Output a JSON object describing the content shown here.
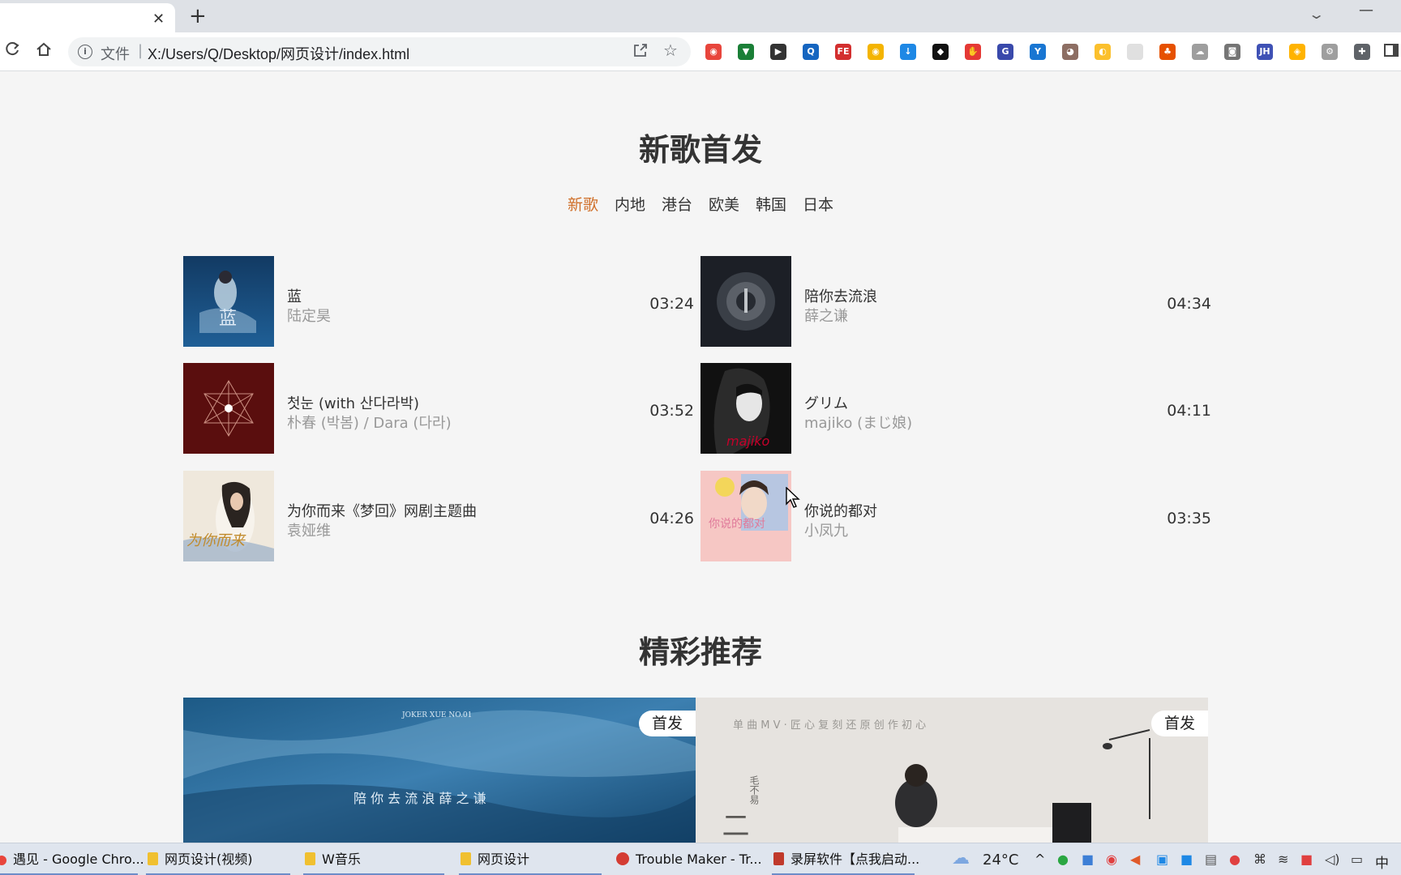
{
  "browser": {
    "tab_close": "✕",
    "new_tab": "+",
    "dropdown": "⌄",
    "minimize": "—",
    "omnibox_label": "文件",
    "omnibox_sep": "|",
    "url": "X:/Users/Q/Desktop/网页设计/index.html",
    "extensions": [
      {
        "name": "chrome-ext-icon",
        "color": "#e8453c",
        "glyph": "◉"
      },
      {
        "name": "shield-ext-icon",
        "color": "#1a7f37",
        "glyph": "▼"
      },
      {
        "name": "dark-ext-icon",
        "color": "#333333",
        "glyph": "▶"
      },
      {
        "name": "search-ext-icon",
        "color": "#1565c0",
        "glyph": "Q"
      },
      {
        "name": "fe-ext-icon",
        "color": "#d32f2f",
        "glyph": "FE"
      },
      {
        "name": "chrome2-ext-icon",
        "color": "#f4b400",
        "glyph": "◉"
      },
      {
        "name": "download-ext-icon",
        "color": "#1e88e5",
        "glyph": "↓"
      },
      {
        "name": "octo-ext-icon",
        "color": "#111111",
        "glyph": "◆"
      },
      {
        "name": "adblock-ext-icon",
        "color": "#e53935",
        "glyph": "✋"
      },
      {
        "name": "g-ext-icon",
        "color": "#3949ab",
        "glyph": "G"
      },
      {
        "name": "y-ext-icon",
        "color": "#1976d2",
        "glyph": "Y"
      },
      {
        "name": "eyes-ext-icon",
        "color": "#8d6e63",
        "glyph": "◕"
      },
      {
        "name": "yellow-ext-icon",
        "color": "#fbc02d",
        "glyph": "◐"
      },
      {
        "name": "blank-ext-icon",
        "color": "#e0e0e0",
        "glyph": ""
      },
      {
        "name": "tree-ext-icon",
        "color": "#e65100",
        "glyph": "♣"
      },
      {
        "name": "cloud-ext-icon",
        "color": "#9e9e9e",
        "glyph": "☁"
      },
      {
        "name": "camera-ext-icon",
        "color": "#757575",
        "glyph": "◙"
      },
      {
        "name": "jh-ext-icon",
        "color": "#3f51b5",
        "glyph": "JH"
      },
      {
        "name": "orange-ext-icon",
        "color": "#ffb300",
        "glyph": "◈"
      },
      {
        "name": "gear-ext-icon",
        "color": "#9e9e9e",
        "glyph": "⚙"
      },
      {
        "name": "puzzle-ext-icon",
        "color": "#5f6368",
        "glyph": "✚"
      }
    ]
  },
  "new_songs": {
    "title": "新歌首发",
    "tabs": [
      "新歌",
      "内地",
      "港台",
      "欧美",
      "韩国",
      "日本"
    ],
    "active_tab": 0,
    "songs": [
      {
        "title": "蓝",
        "artist": "陆定昊",
        "duration": "03:24"
      },
      {
        "title": "陪你去流浪",
        "artist": "薛之谦",
        "duration": "04:34"
      },
      {
        "title": "첫눈 (with 산다라박)",
        "artist": "朴春 (박봄) / Dara (다라)",
        "duration": "03:52"
      },
      {
        "title": "グリム",
        "artist": "majiko (まじ娘)",
        "duration": "04:11"
      },
      {
        "title": "为你而来《梦回》网剧主题曲",
        "artist": "袁娅维",
        "duration": "04:26"
      },
      {
        "title": "你说的都对",
        "artist": "小凤九",
        "duration": "03:35"
      }
    ],
    "cover_art": [
      {
        "line1": "蓝",
        "line2": ""
      },
      {
        "line1": "",
        "line2": ""
      },
      {
        "line1": "",
        "line2": ""
      },
      {
        "line1": "majiko",
        "line2": ""
      },
      {
        "line1": "为你而来",
        "line2": ""
      },
      {
        "line1": "",
        "line2": ""
      }
    ]
  },
  "recommend": {
    "title": "精彩推荐",
    "banners": [
      {
        "badge": "首发",
        "top_text": "JOKER XUE NO.01",
        "caption": "陪 你 去 流 浪   薛 之 谦"
      },
      {
        "badge": "首发",
        "top_text": "单  曲  M  V  ·  匠  心  复  刻      还  原  创  作  初  心",
        "side_text": "毛不易",
        "big_text": "二 零"
      }
    ]
  },
  "taskbar": {
    "items": [
      {
        "label": "遇见 - Google Chro...",
        "icon": "chrome-icon"
      },
      {
        "label": "网页设计(视频)",
        "icon": "folder-icon"
      },
      {
        "label": "W音乐",
        "icon": "folder-icon"
      },
      {
        "label": "网页设计",
        "icon": "folder-icon"
      },
      {
        "label": "Trouble Maker - Tr...",
        "icon": "netease-music-icon"
      },
      {
        "label": "录屏软件【点我启动...",
        "icon": "recorder-icon"
      }
    ],
    "temperature": "24°C",
    "ime": "中"
  }
}
